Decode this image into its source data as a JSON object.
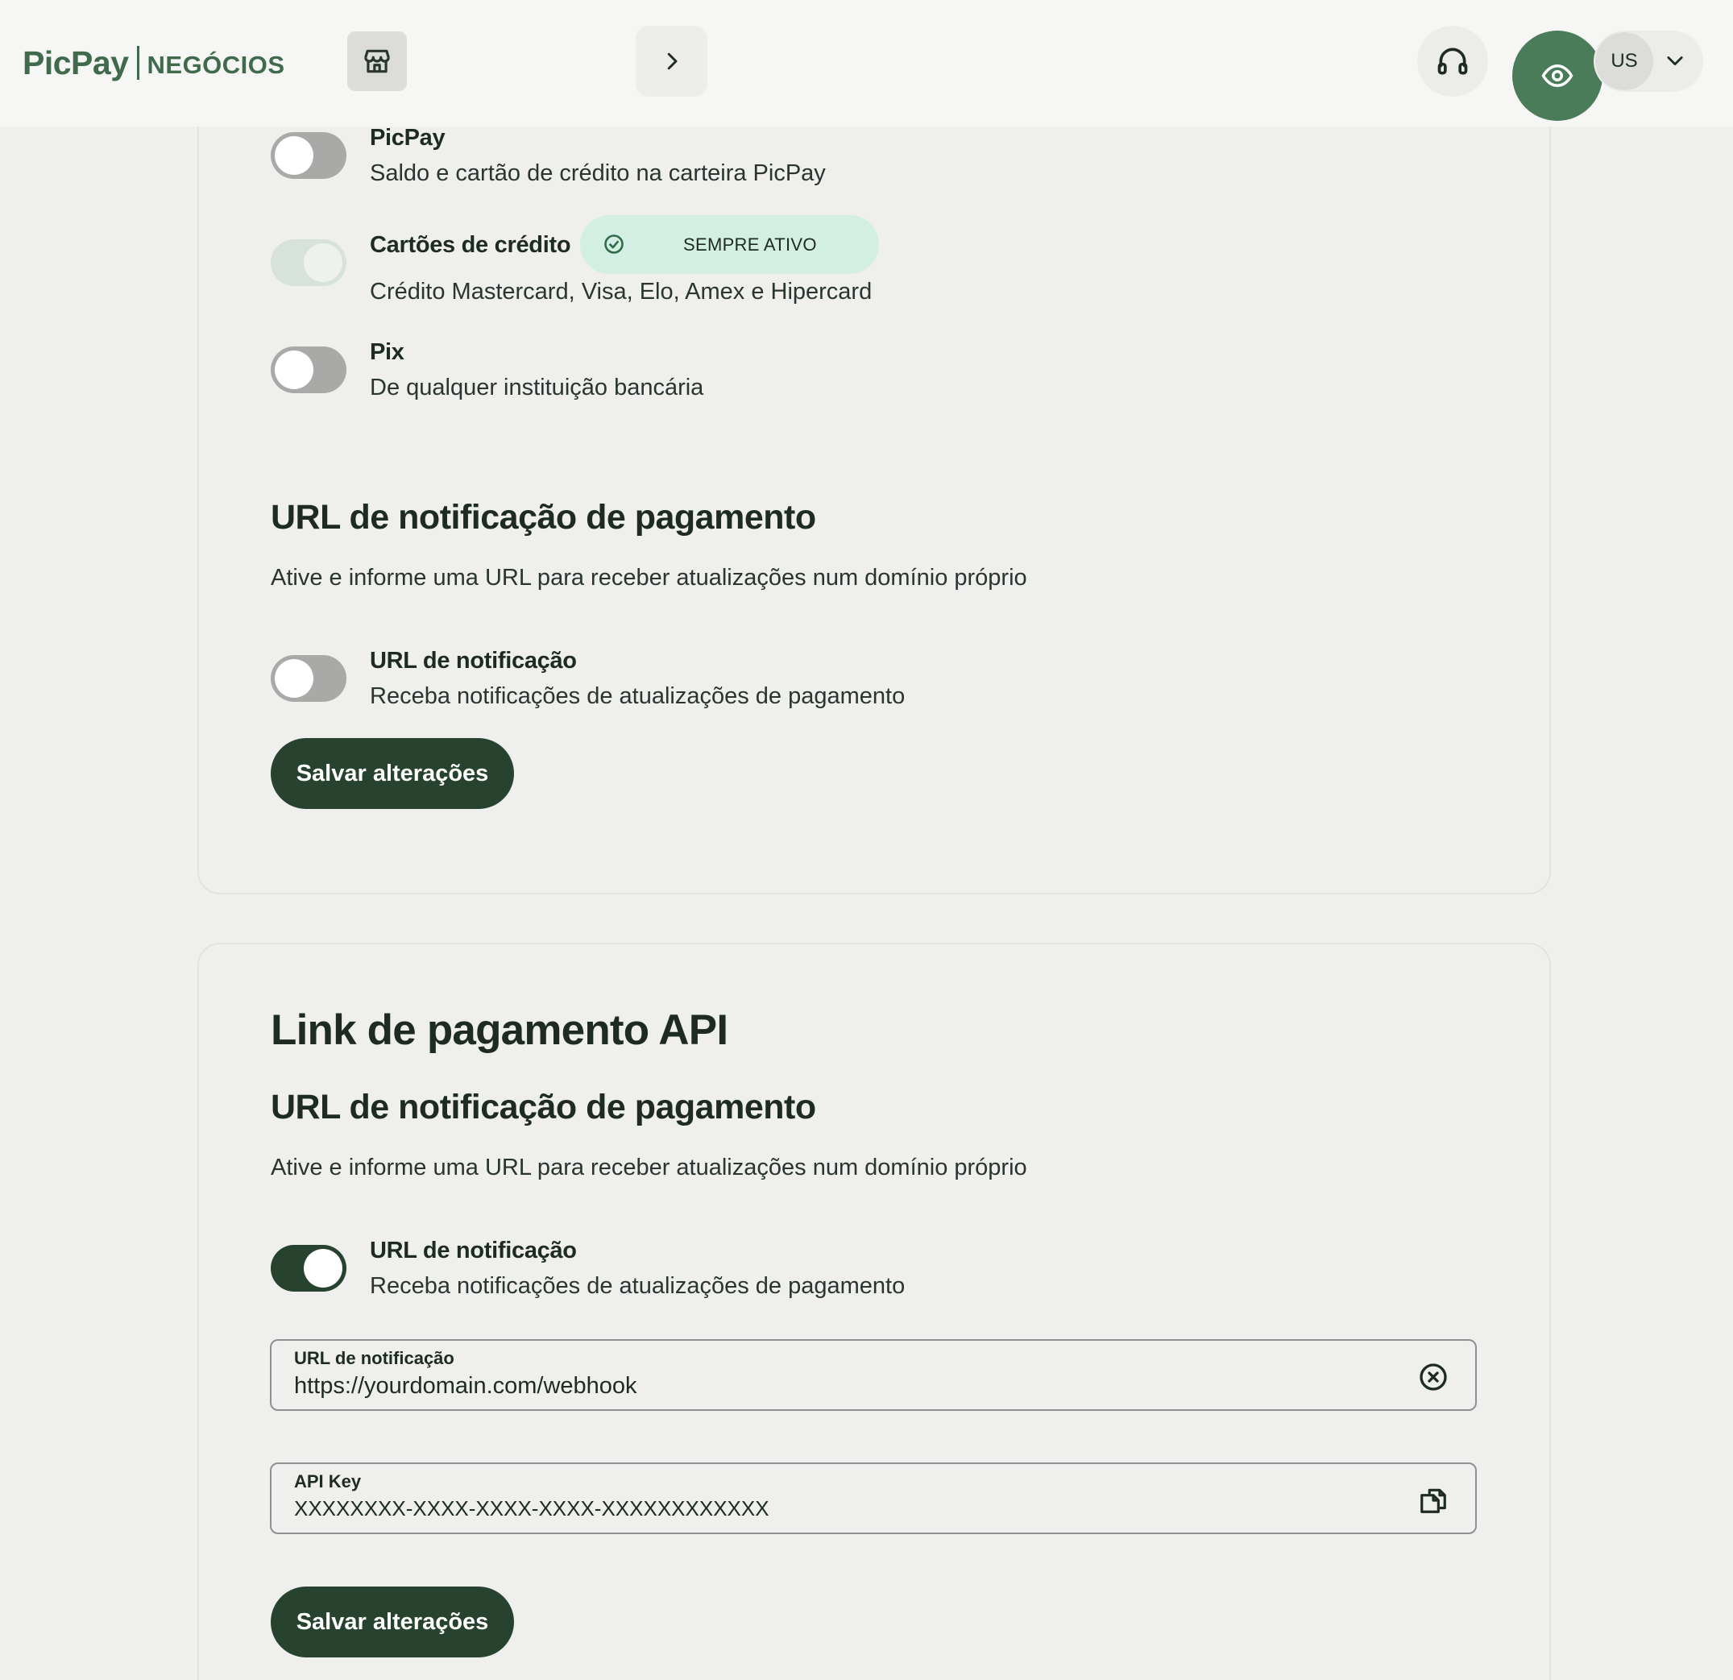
{
  "header": {
    "logo_brand": "PicPay",
    "logo_product": "NEGÓCIOS",
    "user_initials": "US",
    "icons": {
      "store": "store-icon",
      "next": "chevron-right-icon",
      "support": "headset-icon",
      "visibility": "eye-icon",
      "user_menu": "chevron-down-icon"
    },
    "colors": {
      "brand": "#3f6a4c",
      "eye_button": "#4a7c59"
    }
  },
  "payment_methods": [
    {
      "title": "PicPay",
      "description": "Saldo e cartão de crédito na carteira PicPay",
      "enabled": false
    },
    {
      "title": "Cartões de crédito",
      "description": "Crédito Mastercard, Visa, Elo, Amex e Hipercard",
      "enabled": true,
      "badge": "SEMPRE ATIVO"
    },
    {
      "title": "Pix",
      "description": "De qualquer instituição bancária",
      "enabled": false
    }
  ],
  "notification_section_1": {
    "heading": "URL de notificação de pagamento",
    "description": "Ative e informe uma URL para receber atualizações num domínio próprio",
    "toggle_title": "URL de notificação",
    "toggle_description": "Receba notificações de atualizações de pagamento",
    "enabled": false,
    "save_label": "Salvar alterações"
  },
  "api_card": {
    "title": "Link de pagamento API",
    "heading": "URL de notificação de pagamento",
    "description": "Ative e informe uma URL para receber atualizações num domínio próprio",
    "toggle_title": "URL de notificação",
    "toggle_description": "Receba notificações de atualizações de pagamento",
    "enabled": true,
    "url_field": {
      "label": "URL de notificação",
      "value": "https://yourdomain.com/webhook"
    },
    "api_key_field": {
      "label": "API Key",
      "value": "XXXXXXXX-XXXX-XXXX-XXXX-XXXXXXXXXXXX"
    },
    "save_label": "Salvar alterações"
  },
  "colors": {
    "primary_button": "#27432f",
    "badge_bg": "#d3eee2",
    "toggle_off": "#a9a9a7",
    "toggle_on": "#27432f"
  }
}
